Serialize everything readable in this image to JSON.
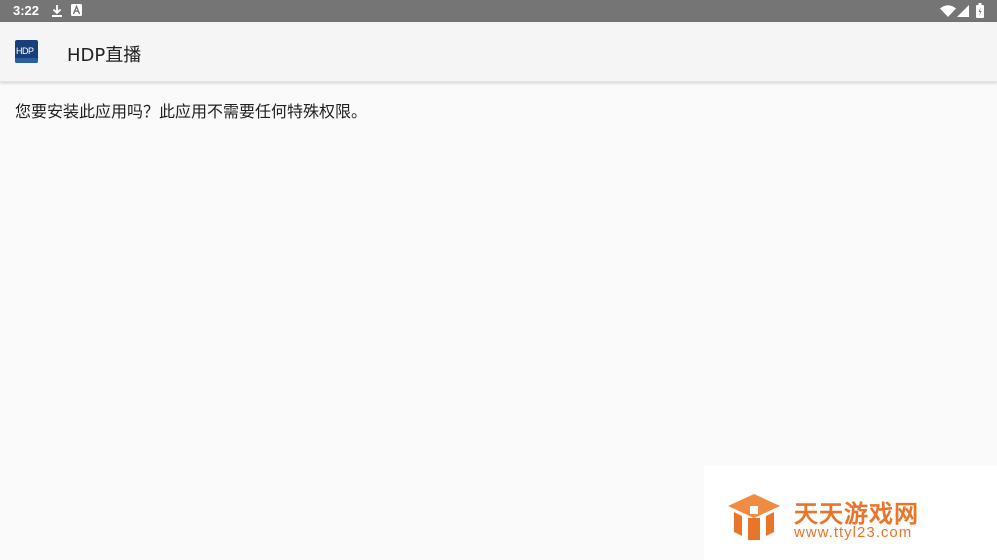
{
  "status_bar": {
    "time": "3:22",
    "left_icons": [
      "download-icon",
      "notification-a-icon"
    ],
    "right_icons": [
      "wifi-icon",
      "cellular-signal-icon",
      "battery-icon"
    ]
  },
  "app_bar": {
    "icon_text": "HDP",
    "title": "HDP直播"
  },
  "message": "您要安装此应用吗？此应用不需要任何特殊权限。",
  "watermark": {
    "name": "天天游戏网",
    "url": "www.ttyl23.com",
    "color": "#e8752a"
  },
  "colors": {
    "status_bar": "#757575",
    "app_bar": "#f5f5f5",
    "background": "#fafafa",
    "text": "#212121"
  }
}
